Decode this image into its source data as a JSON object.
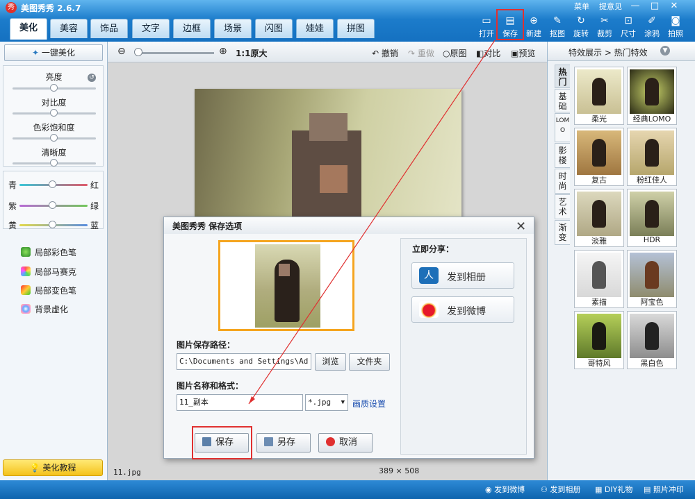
{
  "app": {
    "title": "美图秀秀 2.6.7",
    "logo": "秀",
    "menu": "菜单",
    "feedback": "提意见"
  },
  "tabs": [
    "美化",
    "美容",
    "饰品",
    "文字",
    "边框",
    "场景",
    "闪图",
    "娃娃",
    "拼图"
  ],
  "toolbar": [
    "打开",
    "保存",
    "新建",
    "抠图",
    "旋转",
    "裁剪",
    "尺寸",
    "涂鸦",
    "拍照"
  ],
  "left": {
    "auto_button": "一键美化",
    "sliders": [
      "亮度",
      "对比度",
      "色彩饱和度",
      "清晰度"
    ],
    "colors": [
      {
        "l": "青",
        "r": "红"
      },
      {
        "l": "紫",
        "r": "绿"
      },
      {
        "l": "黄",
        "r": "蓝"
      }
    ],
    "tools": [
      "局部彩色笔",
      "局部马赛克",
      "局部变色笔",
      "背景虚化"
    ],
    "tutorial": "美化教程"
  },
  "canvas": {
    "zoom": "1:1原大",
    "undo": "撤销",
    "redo": "重做",
    "original": "原图",
    "compare": "对比",
    "preview": "预览",
    "filename": "11.jpg",
    "width": "389",
    "height": "508",
    "times": "×"
  },
  "dialog": {
    "title": "美图秀秀 保存选项",
    "path_label": "图片保存路径：",
    "path_value": "C:\\Documents and Settings\\Ad",
    "browse": "浏览",
    "folder": "文件夹",
    "name_label": "图片名称和格式：",
    "name_value": "11_副本",
    "format": "*.jpg",
    "quality": "画质设置",
    "share_title": "立即分享：",
    "share_album": "发到相册",
    "share_weibo": "发到微博",
    "save": "保存",
    "save_as": "另存",
    "cancel": "取消"
  },
  "right": {
    "breadcrumb": "特效展示 > 热门特效",
    "vtabs": [
      "热门",
      "基础",
      "LOMO",
      "影楼",
      "时尚",
      "艺术",
      "渐变"
    ],
    "effects": [
      "柔光",
      "经典LOMO",
      "复古",
      "粉红佳人",
      "淡雅",
      "HDR",
      "素描",
      "阿宝色",
      "哥特风",
      "黑白色"
    ]
  },
  "status": {
    "weibo": "发到微博",
    "album": "发到相册",
    "gift": "DIY礼物",
    "print": "照片冲印"
  },
  "colors": {
    "accent": "#1c7ccb",
    "highlight": "#e03030",
    "thumb_border": "#f5a520"
  }
}
